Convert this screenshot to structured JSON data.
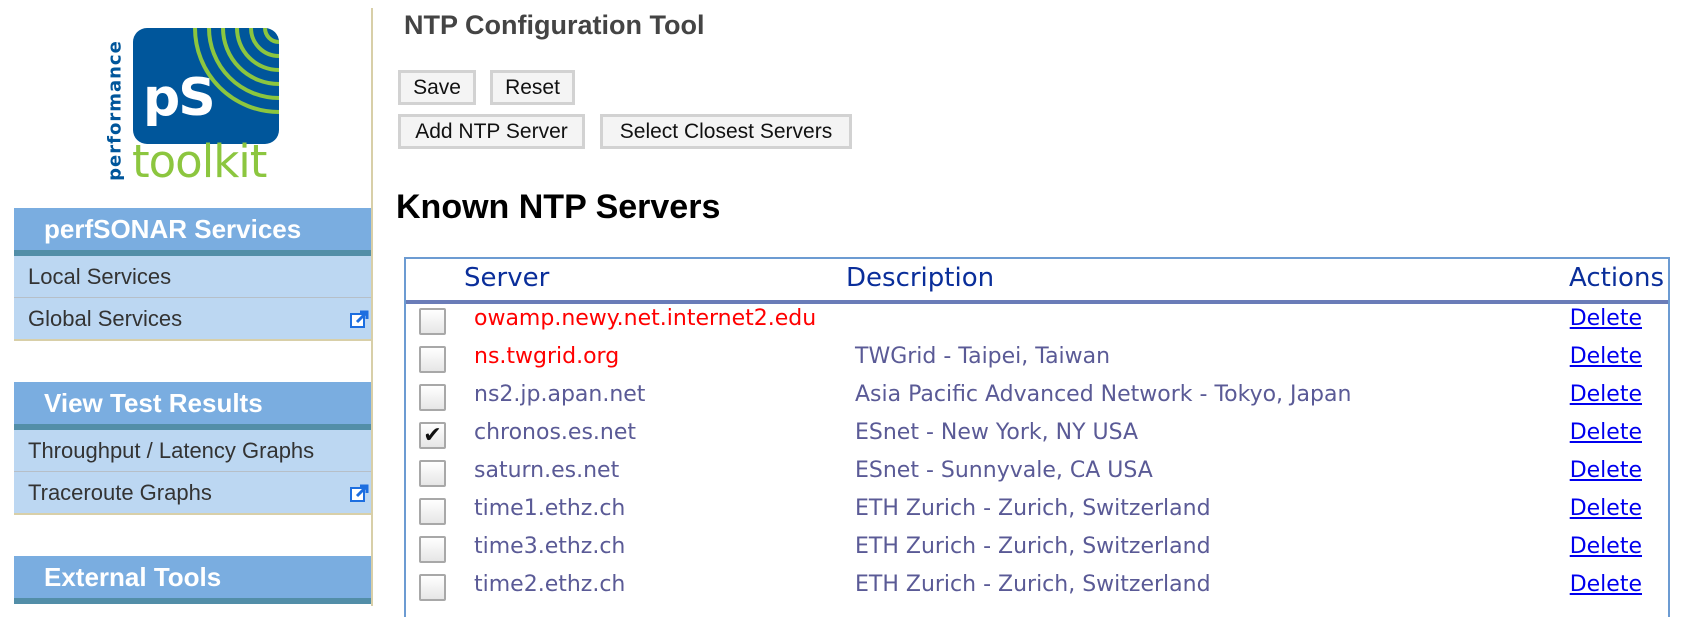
{
  "logo": {
    "mark": "pS",
    "word_vertical": "performance",
    "word_main": "toolkit",
    "colors": {
      "blue": "#00569b",
      "green": "#8cc63f"
    }
  },
  "sidebar": {
    "sections": [
      {
        "header": "perfSONAR Services",
        "items": [
          {
            "label": "Local Services",
            "external": false
          },
          {
            "label": "Global Services",
            "external": true,
            "icon": "external-link-icon"
          }
        ]
      },
      {
        "header": "View Test Results",
        "items": [
          {
            "label": "Throughput / Latency Graphs",
            "external": false
          },
          {
            "label": "Traceroute Graphs",
            "external": true,
            "icon": "external-link-icon"
          }
        ]
      },
      {
        "header": "External Tools",
        "items": []
      }
    ]
  },
  "main": {
    "title": "NTP Configuration Tool",
    "buttons": {
      "save": "Save",
      "reset": "Reset",
      "add_server": "Add NTP Server",
      "select_closest": "Select Closest Servers"
    },
    "section_title": "Known NTP Servers",
    "table": {
      "columns": [
        "Server",
        "Description",
        "Actions"
      ],
      "rows": [
        {
          "checked": false,
          "server": "owamp.newy.net.internet2.edu",
          "description": "",
          "action": "Delete",
          "highlight": true
        },
        {
          "checked": false,
          "server": "ns.twgrid.org",
          "description": "TWGrid - Taipei, Taiwan",
          "action": "Delete",
          "highlight": true
        },
        {
          "checked": false,
          "server": "ns2.jp.apan.net",
          "description": "Asia Pacific Advanced Network - Tokyo, Japan",
          "action": "Delete",
          "highlight": false
        },
        {
          "checked": true,
          "server": "chronos.es.net",
          "description": "ESnet - New York, NY USA",
          "action": "Delete",
          "highlight": false
        },
        {
          "checked": false,
          "server": "saturn.es.net",
          "description": "ESnet - Sunnyvale, CA USA",
          "action": "Delete",
          "highlight": false
        },
        {
          "checked": false,
          "server": "time1.ethz.ch",
          "description": "ETH Zurich - Zurich, Switzerland",
          "action": "Delete",
          "highlight": false
        },
        {
          "checked": false,
          "server": "time3.ethz.ch",
          "description": "ETH Zurich - Zurich, Switzerland",
          "action": "Delete",
          "highlight": false
        },
        {
          "checked": false,
          "server": "time2.ethz.ch",
          "description": "ETH Zurich - Zurich, Switzerland",
          "action": "Delete",
          "highlight": false
        }
      ]
    }
  },
  "colors": {
    "nav_header_bg": "#7aade0",
    "nav_item_bg": "#bcd7f2",
    "table_border": "#6c9bd2",
    "header_text": "#0a2e9a",
    "highlight_red": "#ff0000",
    "row_text": "#5a5a96",
    "link": "#0000ee"
  }
}
